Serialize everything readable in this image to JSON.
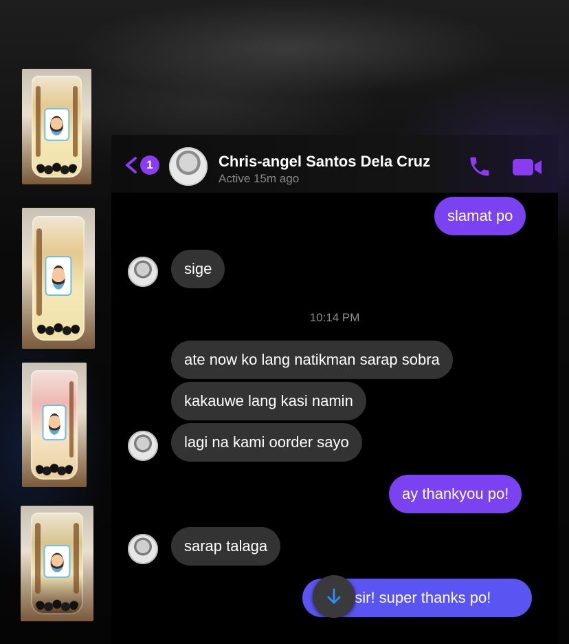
{
  "header": {
    "unread_count": "1",
    "contact_name": "Chris-angel Santos Dela Cruz",
    "status": "Active 15m ago"
  },
  "messages": [
    {
      "direction": "out",
      "text": "slamat po"
    },
    {
      "direction": "in",
      "text": "sige"
    },
    {
      "direction": "in",
      "text": "ate now ko lang natikman sarap sobra"
    },
    {
      "direction": "in",
      "text": "kakauwe lang kasi namin"
    },
    {
      "direction": "in",
      "text": "lagi na kami oorder sayo"
    },
    {
      "direction": "out",
      "text": "ay thankyou po!"
    },
    {
      "direction": "in",
      "text": "sarap talaga"
    },
    {
      "direction": "out",
      "text": "t sir! super thanks po!"
    }
  ],
  "timestamp": "10:14 PM",
  "colors": {
    "accent": "#8a3cf2",
    "outgoing_bubble": "#7a42f0",
    "outgoing_bubble_latest": "#5a54f2",
    "incoming_bubble": "#333334",
    "background": "#000000",
    "scroll_arrow": "#2f8cf5"
  },
  "icons": {
    "back": "chevron-left-icon",
    "call": "phone-icon",
    "video": "video-camera-icon",
    "scroll": "arrow-down-icon"
  }
}
